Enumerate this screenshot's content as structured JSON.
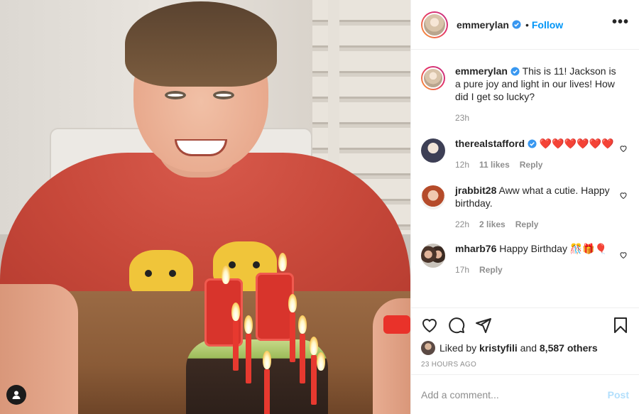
{
  "post_author": {
    "username": "emmerylan",
    "follow_label": "Follow",
    "separator": "•"
  },
  "caption": {
    "username": "emmerylan",
    "text": "This is 11! Jackson is a pure joy and light in our lives! How did I get so lucky?",
    "time": "23h"
  },
  "comments": [
    {
      "username": "therealstafford",
      "text": "❤️❤️❤️❤️❤️❤️",
      "time": "12h",
      "likes": "11 likes",
      "reply_label": "Reply",
      "verified": true
    },
    {
      "username": "jrabbit28",
      "text": "Aww what a cutie. Happy birthday.",
      "time": "22h",
      "likes": "2 likes",
      "reply_label": "Reply",
      "verified": false
    },
    {
      "username": "mharb76",
      "text": "Happy Birthday 🎊🎁🎈",
      "time": "17h",
      "likes": "",
      "reply_label": "Reply",
      "verified": false
    }
  ],
  "likes_summary": {
    "prefix": "Liked by",
    "user": "kristyfili",
    "connector": "and",
    "others": "8,587 others"
  },
  "post_age": "23 HOURS AGO",
  "comment_box": {
    "placeholder": "Add a comment...",
    "post_label": "Post"
  },
  "colors": {
    "link_blue": "#0095f6",
    "post_disabled": "#b2dffc",
    "heart_red": "#ed4956",
    "muted": "#8e8e8e"
  },
  "icons": [
    "verified-badge-icon",
    "more-options-icon",
    "heart-icon",
    "comment-icon",
    "share-icon",
    "bookmark-icon",
    "user-tag-icon"
  ]
}
